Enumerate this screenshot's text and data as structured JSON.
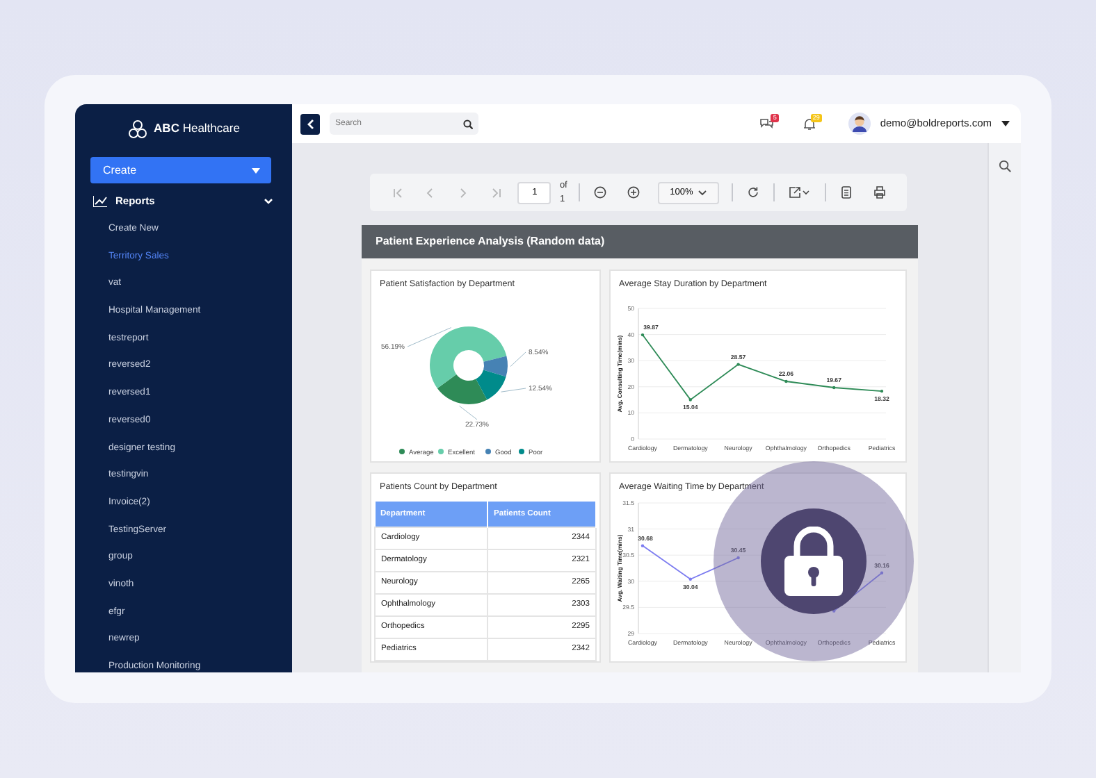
{
  "brand": "**ABC** Healthcare",
  "create_button": "Create",
  "nav_section": {
    "label": "Reports",
    "expanded": true
  },
  "nav_items": [
    {
      "label": "Create New",
      "selected": false
    },
    {
      "label": "Territory Sales",
      "selected": true
    },
    {
      "label": "vat",
      "selected": false
    },
    {
      "label": "Hospital Management",
      "selected": false
    },
    {
      "label": "testreport",
      "selected": false
    },
    {
      "label": "reversed2",
      "selected": false
    },
    {
      "label": "reversed1",
      "selected": false
    },
    {
      "label": "reversed0",
      "selected": false
    },
    {
      "label": "designer testing",
      "selected": false
    },
    {
      "label": "testingvin",
      "selected": false
    },
    {
      "label": "Invoice(2)",
      "selected": false
    },
    {
      "label": "TestingServer",
      "selected": false
    },
    {
      "label": "group",
      "selected": false
    },
    {
      "label": "vinoth",
      "selected": false
    },
    {
      "label": "efgr",
      "selected": false
    },
    {
      "label": "newrep",
      "selected": false
    },
    {
      "label": "Production Monitoring",
      "selected": false
    }
  ],
  "topbar": {
    "search_placeholder": "Search",
    "messages_badge": "5",
    "notifications_badge": "29",
    "user": "demo@boldreports.com"
  },
  "viewer_toolbar": {
    "navigation": [
      {
        "kind": "first",
        "disabled": true
      },
      {
        "kind": "previous",
        "disabled": true
      },
      {
        "kind": "next",
        "disabled": true
      },
      {
        "kind": "last",
        "disabled": true
      }
    ],
    "page": "1",
    "page_count": "of 1",
    "zoom": "100%"
  },
  "report": {
    "title": "Patient Experience Analysis (Random data)",
    "satisfaction": {
      "title": "Patient Satisfaction by Department",
      "chart_data": {
        "type": "donut",
        "categories": [
          "Average",
          "Excellent",
          "Good",
          "Poor"
        ],
        "colors": [
          "#2e8b57",
          "#66cdaa",
          "#4682b4",
          "#008b8b"
        ],
        "values": [
          22.73,
          56.19,
          8.54,
          12.54
        ],
        "value_labels": [
          "22.73%",
          "56.19%",
          "8.54%",
          "12.54%"
        ],
        "legend": "bottom"
      }
    },
    "stay": {
      "title": "Average Stay Duration by Department",
      "chart_data": {
        "type": "line",
        "ylabel": "Avg. Consulting Time(mins)",
        "categories": [
          "Cardiology",
          "Dermatology",
          "Neurology",
          "Ophthalmology",
          "Orthopedics",
          "Pediatrics"
        ],
        "ylim": [
          0,
          50
        ],
        "yticks": [
          0,
          10,
          20,
          30,
          40,
          50
        ],
        "grid": true,
        "series": [
          {
            "color": "#2e8b57",
            "values": [
              39.87,
              15.04,
              28.57,
              22.06,
              19.67,
              18.32
            ]
          }
        ],
        "value_labels": [
          "39.87",
          "15.04",
          "28.57",
          "22.06",
          "19.67",
          "18.32"
        ]
      }
    },
    "count": {
      "title": "Patients Count by Department",
      "columns": [
        "Department",
        "Patients Count"
      ],
      "rows": [
        [
          "Cardiology",
          "2344"
        ],
        [
          "Dermatology",
          "2321"
        ],
        [
          "Neurology",
          "2265"
        ],
        [
          "Ophthalmology",
          "2303"
        ],
        [
          "Orthopedics",
          "2295"
        ],
        [
          "Pediatrics",
          "2342"
        ]
      ]
    },
    "waiting": {
      "title": "Average Waiting Time by Department",
      "chart_data": {
        "type": "line",
        "ylabel": "Avg. Waiting Time(mins)",
        "categories": [
          "Cardiology",
          "Dermatology",
          "Neurology",
          "Ophthalmology",
          "Orthopedics",
          "Pediatrics"
        ],
        "ylim": [
          29,
          31.5
        ],
        "yticks": [
          29,
          29.5,
          30,
          30.5,
          31,
          31.5
        ],
        "grid": true,
        "series": [
          {
            "color": "#7b7bf0",
            "values": [
              30.68,
              30.04,
              30.45,
              null,
              29.43,
              30.16
            ]
          }
        ],
        "value_labels": [
          "30.68",
          "30.04",
          "30.45",
          null,
          null,
          "30.16"
        ]
      }
    }
  }
}
